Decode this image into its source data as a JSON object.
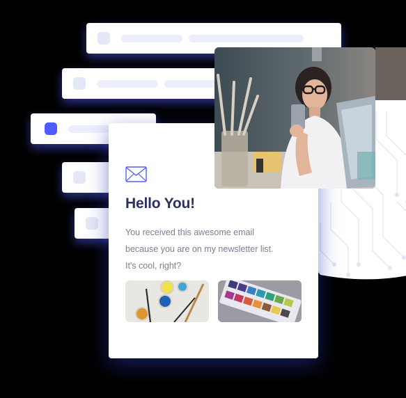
{
  "email": {
    "title": "Hello You!",
    "body_lines": [
      "You received this awesome email",
      "because you are on my newsletter list.",
      "It's cool, right?"
    ]
  },
  "list_rows": [
    {
      "active": false
    },
    {
      "active": false
    },
    {
      "active": true
    },
    {
      "active": false
    },
    {
      "active": false
    }
  ],
  "icons": {
    "envelope": "envelope-icon",
    "row_marker": "square-marker-icon"
  },
  "colors": {
    "accent": "#4f5dff",
    "title": "#2a2f64",
    "body_text": "#7a7f93",
    "placeholder": "#eceffb"
  }
}
